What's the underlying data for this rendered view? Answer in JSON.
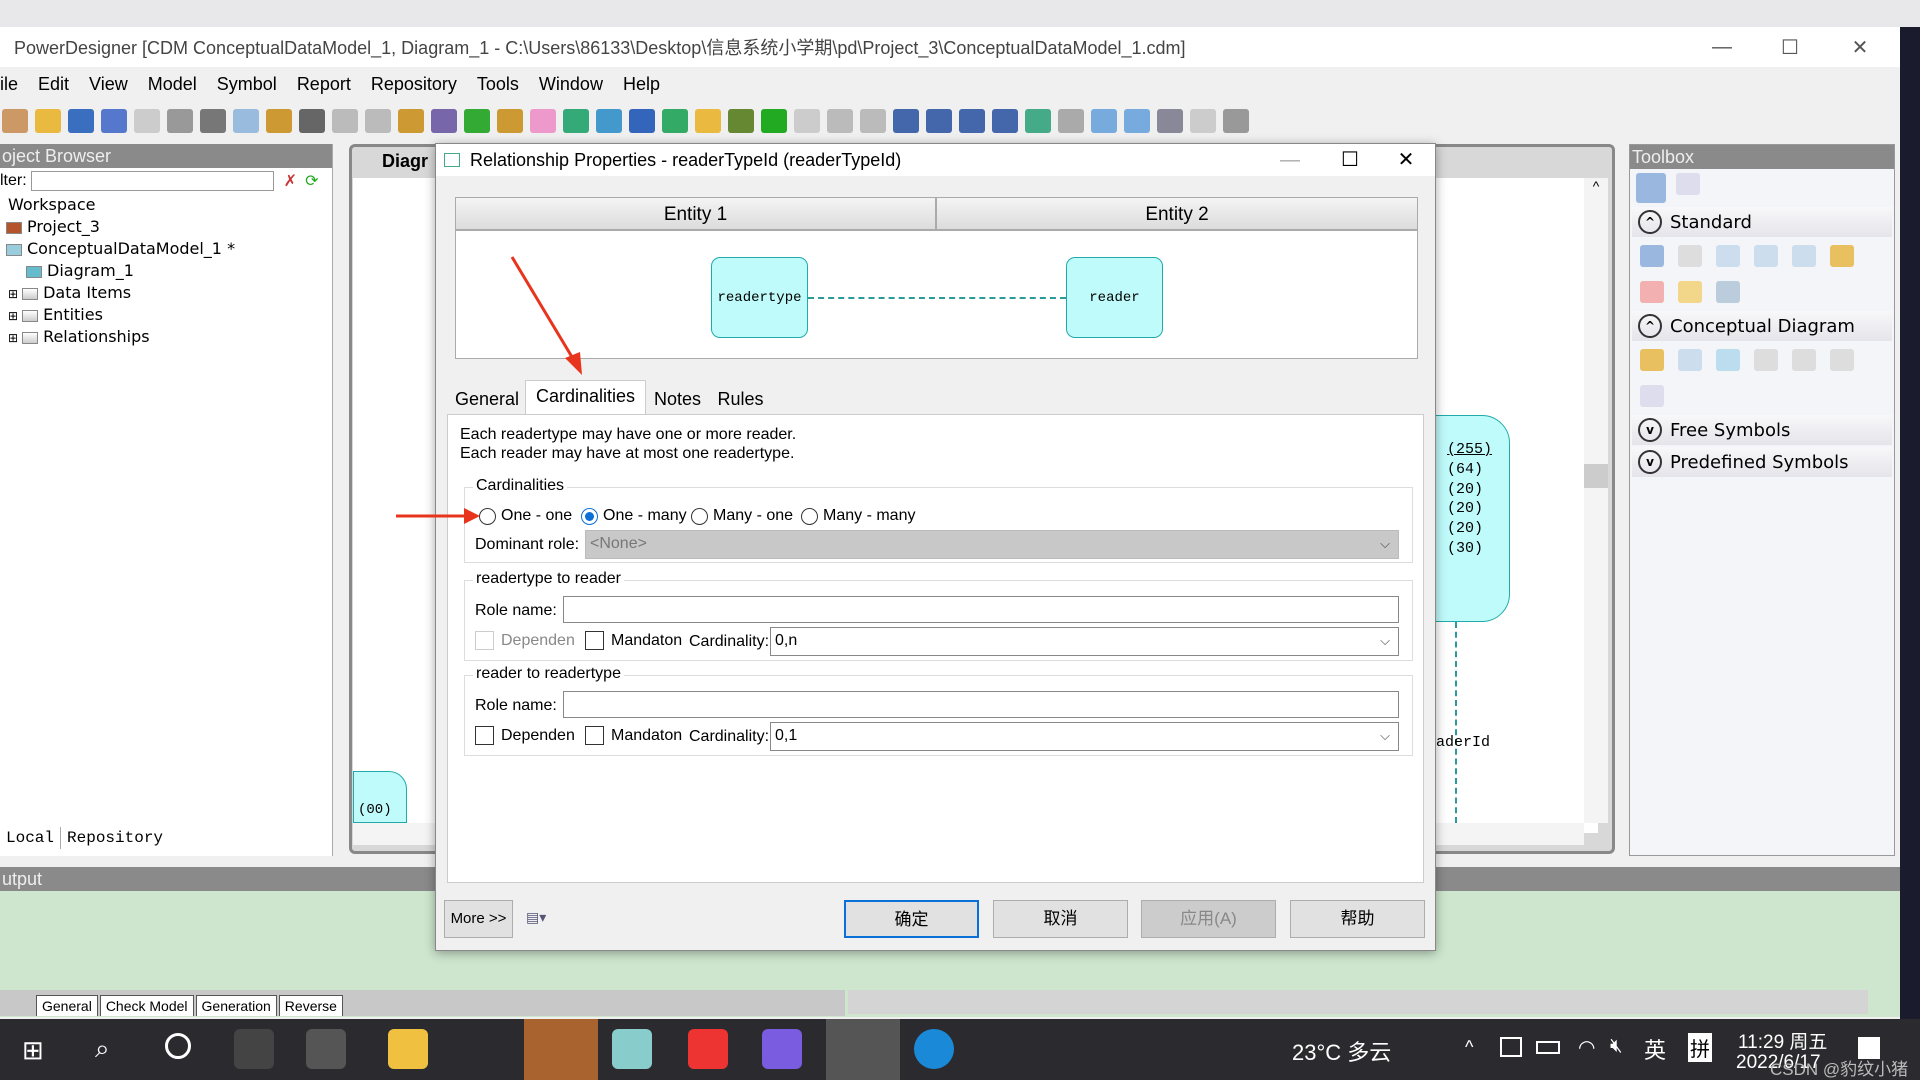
{
  "window": {
    "title": "PowerDesigner [CDM ConceptualDataModel_1, Diagram_1 - C:\\Users\\86133\\Desktop\\信息系统小学期\\pd\\Project_3\\ConceptualDataModel_1.cdm]",
    "minimize": "—",
    "maximize": "☐",
    "close": "✕"
  },
  "menu": [
    "ile",
    "Edit",
    "View",
    "Model",
    "Symbol",
    "Report",
    "Repository",
    "Tools",
    "Window",
    "Help"
  ],
  "browser": {
    "title": "oject Browser",
    "filter_label": "lter:",
    "filter_value": "",
    "tree": [
      "Workspace",
      "Project_3",
      "ConceptualDataModel_1 *",
      "Diagram_1",
      "Data Items",
      "Entities",
      "Relationships"
    ],
    "tabs": [
      "Local",
      "Repository"
    ]
  },
  "diagram": {
    "tab": "Diagr",
    "entity_attrs": [
      "(255)",
      "(64)",
      "(20)",
      "(20)",
      "(20)",
      "(30)"
    ],
    "partial_label": "aderId",
    "bottom_partial": "(00)"
  },
  "toolbox": {
    "title": "Toolbox",
    "sections": [
      "Standard",
      "Conceptual Diagram",
      "Free Symbols",
      "Predefined Symbols"
    ]
  },
  "output": {
    "title": "utput",
    "tabs": [
      "General",
      "Check Model",
      "Generation",
      "Reverse"
    ]
  },
  "dialog": {
    "title": "Relationship Properties - readerTypeId (readerTypeId)",
    "entity1": "Entity 1",
    "entity2": "Entity 2",
    "entity1_name": "readertype",
    "entity2_name": "reader",
    "tabs": [
      "General",
      "Cardinalities",
      "Notes",
      "Rules"
    ],
    "active_tab": "Cardinalities",
    "desc1": "Each readertype may have one or more reader.",
    "desc2": "Each reader may have at most one readertype.",
    "card_group": "Cardinalities",
    "radios": [
      "One - one",
      "One - many",
      "Many - one",
      "Many - many"
    ],
    "selected_radio": "One - many",
    "dominant_label": "Dominant role:",
    "dominant_value": "<None>",
    "g1": {
      "title": "readertype to reader",
      "role_label": "Role name:",
      "role_value": "",
      "dependent": "Dependen",
      "dependent_checked": false,
      "dependent_enabled": false,
      "mandatory": "Mandaton",
      "mandatory_checked": false,
      "card_label": "Cardinality:",
      "card_value": "0,n"
    },
    "g2": {
      "title": "reader to readertype",
      "role_label": "Role name:",
      "role_value": "",
      "dependent": "Dependen",
      "dependent_checked": false,
      "mandatory": "Mandaton",
      "mandatory_checked": false,
      "card_label": "Cardinality:",
      "card_value": "0,1"
    },
    "more": "More >>",
    "ok": "确定",
    "cancel": "取消",
    "apply": "应用(A)",
    "help": "帮助"
  },
  "taskbar": {
    "weather": "23°C 多云",
    "ime1": "英",
    "ime2": "拼",
    "time": "11:29 周五",
    "date": "2022/6/17",
    "watermark": "CSDN @豹纹小猪"
  },
  "colors": {
    "entity_fill": "#c0fbfb",
    "annotation_arrow": "#e8341c",
    "output_bg": "#cde6cd",
    "accent": "#0a6fd6"
  }
}
